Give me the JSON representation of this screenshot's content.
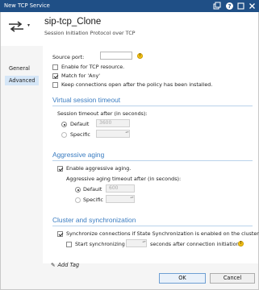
{
  "window": {
    "title": "New TCP Service",
    "icons": [
      "window-back-icon",
      "help-icon",
      "maximize-icon",
      "close-icon"
    ]
  },
  "header": {
    "name": "sip-tcp_Clone",
    "description": "Session Initiation Protocol over TCP",
    "caret": "▾"
  },
  "sidebar": {
    "items": [
      {
        "label": "General",
        "active": false
      },
      {
        "label": "Advanced",
        "active": true
      }
    ]
  },
  "source_port": {
    "label": "Source port:",
    "value": ""
  },
  "options": {
    "enable_tcp": {
      "label": "Enable for TCP resource.",
      "checked": false
    },
    "match_any": {
      "label": "Match for 'Any'",
      "checked": true
    },
    "keep_open": {
      "label": "Keep connections open after the policy has been installed.",
      "checked": false
    }
  },
  "virtual_session": {
    "heading": "Virtual session timeout",
    "sub_label": "Session timeout after (in seconds):",
    "default_label": "Default",
    "default_value": "3600",
    "specific_label": "Specific",
    "selected": "default"
  },
  "aggressive": {
    "heading": "Aggressive aging",
    "enable_label": "Enable aggressive aging.",
    "enabled": true,
    "sub_label": "Aggressive aging timeout after (in seconds):",
    "default_label": "Default",
    "default_value": "600",
    "specific_label": "Specific",
    "selected": "default"
  },
  "cluster": {
    "heading": "Cluster and synchronization",
    "sync_label": "Synchronize connections if State Synchronization is enabled on the cluster.",
    "sync_checked": true,
    "start_label": "Start synchronizing",
    "start_suffix": "seconds after connection initiation.",
    "start_checked": false
  },
  "footer": {
    "add_tag": "Add Tag",
    "ok": "OK",
    "cancel": "Cancel"
  },
  "colors": {
    "titlebar": "#1f4f86",
    "section": "#3a7cc1",
    "active_nav": "#d5e6f7",
    "help": "#f3c117"
  }
}
